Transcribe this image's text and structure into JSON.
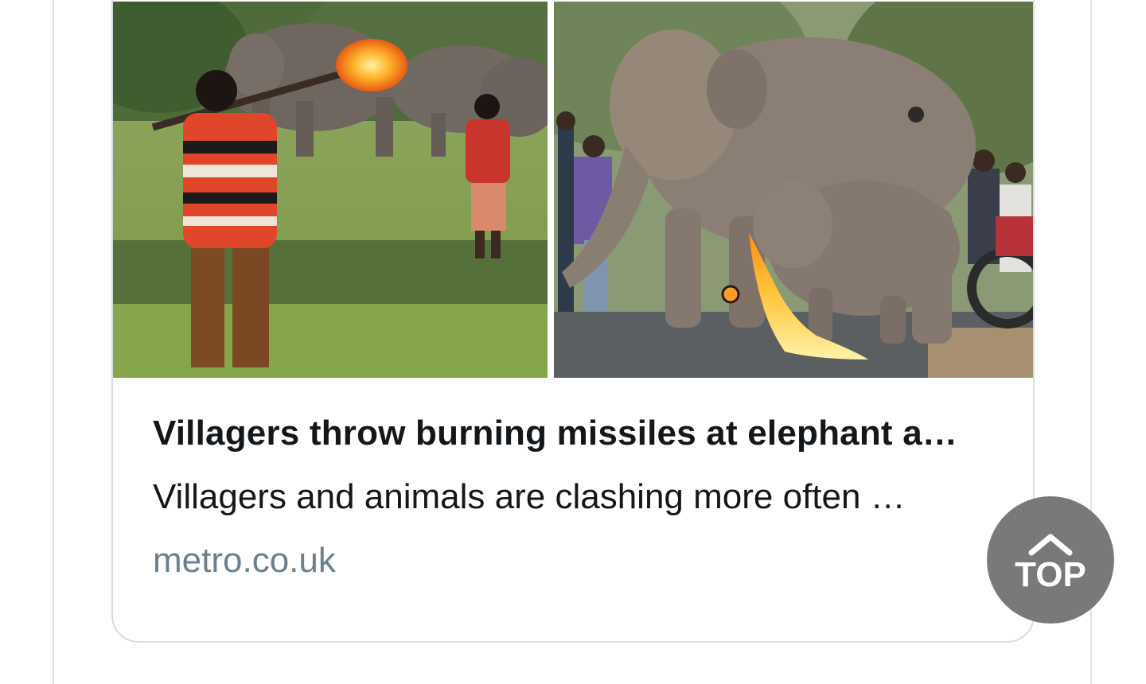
{
  "card": {
    "title": "Villagers throw burning missiles at elephant a…",
    "description": "Villagers and animals are clashing more often …",
    "domain": "metro.co.uk",
    "images": [
      {
        "alt_icon": "photo-villagers-elephants-field"
      },
      {
        "alt_icon": "photo-elephant-calf-fire"
      }
    ]
  },
  "scroll_top": {
    "label": "TOP",
    "icon": "chevron-up-icon"
  },
  "colors": {
    "title_text": "#14171a",
    "domain_text": "#6b7f8f",
    "card_border": "#d7dde3",
    "top_button_bg": "#6e6e6e"
  }
}
